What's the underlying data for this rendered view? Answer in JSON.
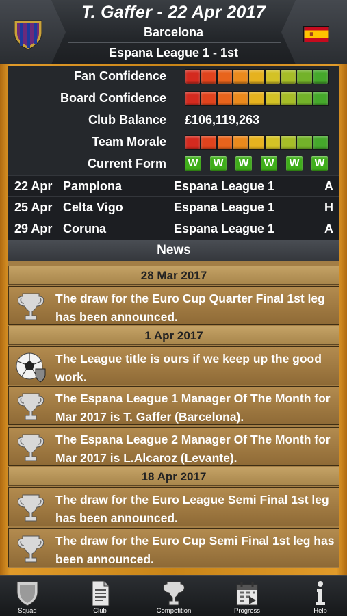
{
  "header": {
    "title": "T. Gaffer  - 22 Apr 2017",
    "club": "Barcelona",
    "league_position": "Espana League 1 - 1st",
    "crest_icon": "club-crest-icon",
    "flag_icon": "spain-flag-icon"
  },
  "stats": {
    "fan_confidence": {
      "label": "Fan Confidence",
      "level": 1.0
    },
    "board_confidence": {
      "label": "Board Confidence",
      "level": 1.0
    },
    "club_balance": {
      "label": "Club Balance",
      "value": "£106,119,263"
    },
    "team_morale": {
      "label": "Team Morale",
      "level": 1.0
    },
    "current_form": {
      "label": "Current Form",
      "results": [
        "W",
        "W",
        "W",
        "W",
        "W",
        "W"
      ]
    }
  },
  "fixtures": [
    {
      "date": "22 Apr",
      "opponent": "Pamplona",
      "competition": "Espana League 1",
      "venue": "A"
    },
    {
      "date": "25 Apr",
      "opponent": "Celta Vigo",
      "competition": "Espana League 1",
      "venue": "H"
    },
    {
      "date": "29 Apr",
      "opponent": "Coruna",
      "competition": "Espana League 1",
      "venue": "A"
    }
  ],
  "news": {
    "title": "News",
    "dates": [
      "28 Mar 2017",
      "1 Apr 2017",
      "18 Apr 2017"
    ],
    "items": [
      {
        "icon": "trophy-icon",
        "text": "The draw for the Euro Cup Quarter Final 1st leg has been announced."
      },
      {
        "icon": "football-shield-icon",
        "text": "The League title is ours if we keep up the good work."
      },
      {
        "icon": "trophy-icon",
        "text": "The Espana League 1 Manager Of The Month for Mar 2017 is T. Gaffer (Barcelona)."
      },
      {
        "icon": "trophy-icon",
        "text": "The Espana League 2 Manager Of The Month for Mar 2017 is L.Alcaroz (Levante)."
      },
      {
        "icon": "trophy-icon",
        "text": "The draw for the Euro League Semi Final 1st leg has been announced."
      },
      {
        "icon": "trophy-icon",
        "text": "The draw for the Euro Cup Semi Final 1st leg has been announced."
      }
    ]
  },
  "nav": {
    "squad": {
      "label": "Squad",
      "icon": "shield-icon"
    },
    "club": {
      "label": "Club",
      "icon": "document-icon"
    },
    "competition": {
      "label": "Competition",
      "icon": "trophy-icon"
    },
    "progress": {
      "label": "Progress",
      "icon": "calendar-icon"
    },
    "help": {
      "label": "Help",
      "icon": "info-icon"
    }
  },
  "colors": {
    "frame_orange": "#e19b2a",
    "form_green": "#3fae1a",
    "news_brown": "#a37e46"
  }
}
